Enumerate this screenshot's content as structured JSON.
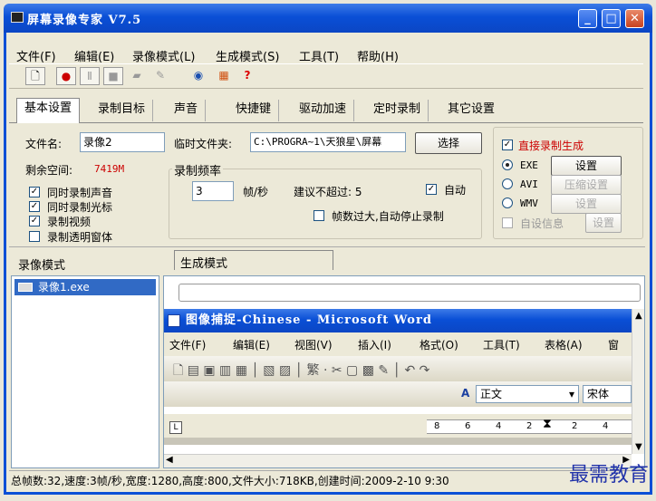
{
  "window": {
    "title": "屏幕录像专家 V7.5"
  },
  "menu": [
    "文件(F)",
    "编辑(E)",
    "录像模式(L)",
    "生成模式(S)",
    "工具(T)",
    "帮助(H)"
  ],
  "toolbar": [
    "new-icon",
    "record-icon",
    "pause-icon",
    "stop-icon",
    "camera-icon",
    "pen-icon",
    "globe-icon",
    "paint-icon",
    "help-icon"
  ],
  "tabs": [
    "基本设置",
    "录制目标",
    "声音",
    "快捷键",
    "驱动加速",
    "定时录制",
    "其它设置"
  ],
  "basic": {
    "filename_label": "文件名:",
    "filename_value": "录像2",
    "tempdir_label": "临时文件夹:",
    "tempdir_value": "C:\\PROGRA~1\\天狼星\\屏幕",
    "browse_btn": "选择",
    "free_space_label": "剩余空间:",
    "free_space_value": "7419M",
    "checks": [
      {
        "label": "同时录制声音",
        "checked": true
      },
      {
        "label": "同时录制光标",
        "checked": true
      },
      {
        "label": "录制视频",
        "checked": true
      },
      {
        "label": "录制透明窗体",
        "checked": false
      }
    ],
    "freq_group": "录制频率",
    "fps_value": "3",
    "fps_unit": "帧/秒",
    "suggest": "建议不超过: 5",
    "auto_label": "自动",
    "auto_checked": true,
    "autostop_label": "帧数过大,自动停止录制",
    "direct_label": "直接录制生成",
    "formats": [
      {
        "label": "EXE",
        "btn": "设置",
        "selected": true,
        "btn_enabled": true
      },
      {
        "label": "AVI",
        "btn": "压缩设置",
        "selected": false,
        "btn_enabled": false
      },
      {
        "label": "WMV",
        "btn": "设置",
        "selected": false,
        "btn_enabled": false
      }
    ],
    "custom_info_label": "自设信息",
    "custom_info_btn": "设置"
  },
  "panels": {
    "record_mode": "录像模式",
    "gen_mode": "生成模式",
    "list_item": "录像1.exe"
  },
  "preview": {
    "title": "图像捕捉-Chinese - Microsoft Word",
    "menu": [
      "文件(F)",
      "编辑(E)",
      "视图(V)",
      "插入(I)",
      "格式(O)",
      "工具(T)",
      "表格(A)",
      "窗"
    ],
    "style_value": "正文",
    "font_value": "宋体",
    "ruler_nums": [
      "8",
      "6",
      "4",
      "2",
      "2",
      "4"
    ]
  },
  "status": "总帧数:32,速度:3帧/秒,宽度:1280,高度:800,文件大小:718KB,创建时间:2009-2-10 9:30",
  "watermark": "最需教育"
}
